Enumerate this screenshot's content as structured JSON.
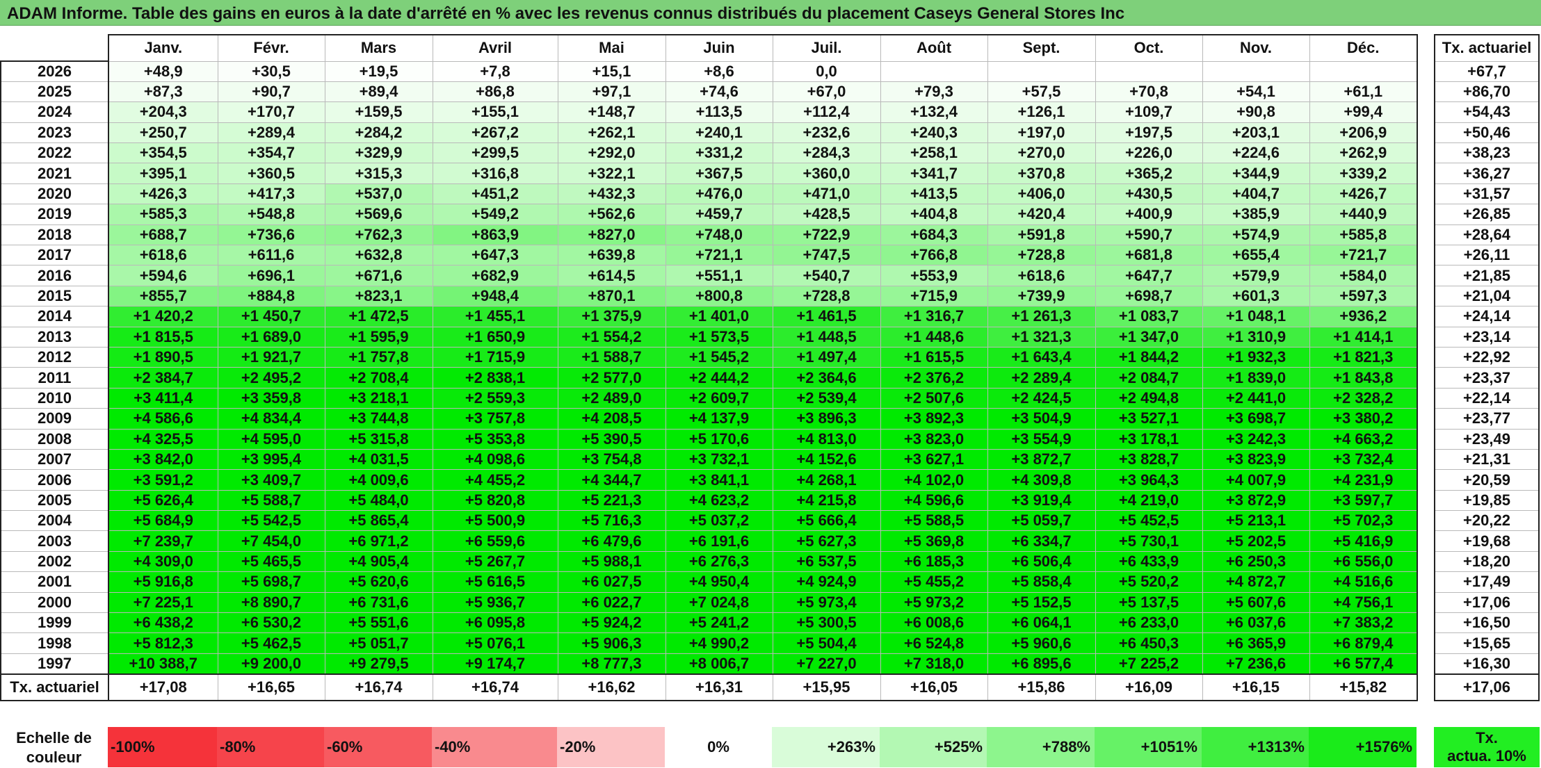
{
  "title": "ADAM Informe. Table des gains en euros à la date d'arrêté en % avec les revenus connus distribués du placement Caseys General Stores Inc",
  "months": [
    "Janv.",
    "Févr.",
    "Mars",
    "Avril",
    "Mai",
    "Juin",
    "Juil.",
    "Août",
    "Sept.",
    "Oct.",
    "Nov.",
    "Déc."
  ],
  "act_header": "Tx. actuariel",
  "rows": [
    {
      "year": "2026",
      "values": [
        "+48,9",
        "+30,5",
        "+19,5",
        "+7,8",
        "+15,1",
        "+8,6",
        "0,0",
        "",
        "",
        "",
        "",
        ""
      ],
      "act": "+67,7"
    },
    {
      "year": "2025",
      "values": [
        "+87,3",
        "+90,7",
        "+89,4",
        "+86,8",
        "+97,1",
        "+74,6",
        "+67,0",
        "+79,3",
        "+57,5",
        "+70,8",
        "+54,1",
        "+61,1"
      ],
      "act": "+86,70"
    },
    {
      "year": "2024",
      "values": [
        "+204,3",
        "+170,7",
        "+159,5",
        "+155,1",
        "+148,7",
        "+113,5",
        "+112,4",
        "+132,4",
        "+126,1",
        "+109,7",
        "+90,8",
        "+99,4"
      ],
      "act": "+54,43"
    },
    {
      "year": "2023",
      "values": [
        "+250,7",
        "+289,4",
        "+284,2",
        "+267,2",
        "+262,1",
        "+240,1",
        "+232,6",
        "+240,3",
        "+197,0",
        "+197,5",
        "+203,1",
        "+206,9"
      ],
      "act": "+50,46"
    },
    {
      "year": "2022",
      "values": [
        "+354,5",
        "+354,7",
        "+329,9",
        "+299,5",
        "+292,0",
        "+331,2",
        "+284,3",
        "+258,1",
        "+270,0",
        "+226,0",
        "+224,6",
        "+262,9"
      ],
      "act": "+38,23"
    },
    {
      "year": "2021",
      "values": [
        "+395,1",
        "+360,5",
        "+315,3",
        "+316,8",
        "+322,1",
        "+367,5",
        "+360,0",
        "+341,7",
        "+370,8",
        "+365,2",
        "+344,9",
        "+339,2"
      ],
      "act": "+36,27"
    },
    {
      "year": "2020",
      "values": [
        "+426,3",
        "+417,3",
        "+537,0",
        "+451,2",
        "+432,3",
        "+476,0",
        "+471,0",
        "+413,5",
        "+406,0",
        "+430,5",
        "+404,7",
        "+426,7"
      ],
      "act": "+31,57"
    },
    {
      "year": "2019",
      "values": [
        "+585,3",
        "+548,8",
        "+569,6",
        "+549,2",
        "+562,6",
        "+459,7",
        "+428,5",
        "+404,8",
        "+420,4",
        "+400,9",
        "+385,9",
        "+440,9"
      ],
      "act": "+26,85"
    },
    {
      "year": "2018",
      "values": [
        "+688,7",
        "+736,6",
        "+762,3",
        "+863,9",
        "+827,0",
        "+748,0",
        "+722,9",
        "+684,3",
        "+591,8",
        "+590,7",
        "+574,9",
        "+585,8"
      ],
      "act": "+28,64"
    },
    {
      "year": "2017",
      "values": [
        "+618,6",
        "+611,6",
        "+632,8",
        "+647,3",
        "+639,8",
        "+721,1",
        "+747,5",
        "+766,8",
        "+728,8",
        "+681,8",
        "+655,4",
        "+721,7"
      ],
      "act": "+26,11"
    },
    {
      "year": "2016",
      "values": [
        "+594,6",
        "+696,1",
        "+671,6",
        "+682,9",
        "+614,5",
        "+551,1",
        "+540,7",
        "+553,9",
        "+618,6",
        "+647,7",
        "+579,9",
        "+584,0"
      ],
      "act": "+21,85"
    },
    {
      "year": "2015",
      "values": [
        "+855,7",
        "+884,8",
        "+823,1",
        "+948,4",
        "+870,1",
        "+800,8",
        "+728,8",
        "+715,9",
        "+739,9",
        "+698,7",
        "+601,3",
        "+597,3"
      ],
      "act": "+21,04"
    },
    {
      "year": "2014",
      "values": [
        "+1 420,2",
        "+1 450,7",
        "+1 472,5",
        "+1 455,1",
        "+1 375,9",
        "+1 401,0",
        "+1 461,5",
        "+1 316,7",
        "+1 261,3",
        "+1 083,7",
        "+1 048,1",
        "+936,2"
      ],
      "act": "+24,14"
    },
    {
      "year": "2013",
      "values": [
        "+1 815,5",
        "+1 689,0",
        "+1 595,9",
        "+1 650,9",
        "+1 554,2",
        "+1 573,5",
        "+1 448,5",
        "+1 448,6",
        "+1 321,3",
        "+1 347,0",
        "+1 310,9",
        "+1 414,1"
      ],
      "act": "+23,14"
    },
    {
      "year": "2012",
      "values": [
        "+1 890,5",
        "+1 921,7",
        "+1 757,8",
        "+1 715,9",
        "+1 588,7",
        "+1 545,2",
        "+1 497,4",
        "+1 615,5",
        "+1 643,4",
        "+1 844,2",
        "+1 932,3",
        "+1 821,3"
      ],
      "act": "+22,92"
    },
    {
      "year": "2011",
      "values": [
        "+2 384,7",
        "+2 495,2",
        "+2 708,4",
        "+2 838,1",
        "+2 577,0",
        "+2 444,2",
        "+2 364,6",
        "+2 376,2",
        "+2 289,4",
        "+2 084,7",
        "+1 839,0",
        "+1 843,8"
      ],
      "act": "+23,37"
    },
    {
      "year": "2010",
      "values": [
        "+3 411,4",
        "+3 359,8",
        "+3 218,1",
        "+2 559,3",
        "+2 489,0",
        "+2 609,7",
        "+2 539,4",
        "+2 507,6",
        "+2 424,5",
        "+2 494,8",
        "+2 441,0",
        "+2 328,2"
      ],
      "act": "+22,14"
    },
    {
      "year": "2009",
      "values": [
        "+4 586,6",
        "+4 834,4",
        "+3 744,8",
        "+3 757,8",
        "+4 208,5",
        "+4 137,9",
        "+3 896,3",
        "+3 892,3",
        "+3 504,9",
        "+3 527,1",
        "+3 698,7",
        "+3 380,2"
      ],
      "act": "+23,77"
    },
    {
      "year": "2008",
      "values": [
        "+4 325,5",
        "+4 595,0",
        "+5 315,8",
        "+5 353,8",
        "+5 390,5",
        "+5 170,6",
        "+4 813,0",
        "+3 823,0",
        "+3 554,9",
        "+3 178,1",
        "+3 242,3",
        "+4 663,2"
      ],
      "act": "+23,49"
    },
    {
      "year": "2007",
      "values": [
        "+3 842,0",
        "+3 995,4",
        "+4 031,5",
        "+4 098,6",
        "+3 754,8",
        "+3 732,1",
        "+4 152,6",
        "+3 627,1",
        "+3 872,7",
        "+3 828,7",
        "+3 823,9",
        "+3 732,4"
      ],
      "act": "+21,31"
    },
    {
      "year": "2006",
      "values": [
        "+3 591,2",
        "+3 409,7",
        "+4 009,6",
        "+4 455,2",
        "+4 344,7",
        "+3 841,1",
        "+4 268,1",
        "+4 102,0",
        "+4 309,8",
        "+3 964,3",
        "+4 007,9",
        "+4 231,9"
      ],
      "act": "+20,59"
    },
    {
      "year": "2005",
      "values": [
        "+5 626,4",
        "+5 588,7",
        "+5 484,0",
        "+5 820,8",
        "+5 221,3",
        "+4 623,2",
        "+4 215,8",
        "+4 596,6",
        "+3 919,4",
        "+4 219,0",
        "+3 872,9",
        "+3 597,7"
      ],
      "act": "+19,85"
    },
    {
      "year": "2004",
      "values": [
        "+5 684,9",
        "+5 542,5",
        "+5 865,4",
        "+5 500,9",
        "+5 716,3",
        "+5 037,2",
        "+5 666,4",
        "+5 588,5",
        "+5 059,7",
        "+5 452,5",
        "+5 213,1",
        "+5 702,3"
      ],
      "act": "+20,22"
    },
    {
      "year": "2003",
      "values": [
        "+7 239,7",
        "+7 454,0",
        "+6 971,2",
        "+6 559,6",
        "+6 479,6",
        "+6 191,6",
        "+5 627,3",
        "+5 369,8",
        "+6 334,7",
        "+5 730,1",
        "+5 202,5",
        "+5 416,9"
      ],
      "act": "+19,68"
    },
    {
      "year": "2002",
      "values": [
        "+4 309,0",
        "+5 465,5",
        "+4 905,4",
        "+5 267,7",
        "+5 988,1",
        "+6 276,3",
        "+6 537,5",
        "+6 185,3",
        "+6 506,4",
        "+6 433,9",
        "+6 250,3",
        "+6 556,0"
      ],
      "act": "+18,20"
    },
    {
      "year": "2001",
      "values": [
        "+5 916,8",
        "+5 698,7",
        "+5 620,6",
        "+5 616,5",
        "+6 027,5",
        "+4 950,4",
        "+4 924,9",
        "+5 455,2",
        "+5 858,4",
        "+5 520,2",
        "+4 872,7",
        "+4 516,6"
      ],
      "act": "+17,49"
    },
    {
      "year": "2000",
      "values": [
        "+7 225,1",
        "+8 890,7",
        "+6 731,6",
        "+5 936,7",
        "+6 022,7",
        "+7 024,8",
        "+5 973,4",
        "+5 973,2",
        "+5 152,5",
        "+5 137,5",
        "+5 607,6",
        "+4 756,1"
      ],
      "act": "+17,06"
    },
    {
      "year": "1999",
      "values": [
        "+6 438,2",
        "+6 530,2",
        "+5 551,6",
        "+6 095,8",
        "+5 924,2",
        "+5 241,2",
        "+5 300,5",
        "+6 008,6",
        "+6 064,1",
        "+6 233,0",
        "+6 037,6",
        "+7 383,2"
      ],
      "act": "+16,50"
    },
    {
      "year": "1998",
      "values": [
        "+5 812,3",
        "+5 462,5",
        "+5 051,7",
        "+5 076,1",
        "+5 906,3",
        "+4 990,2",
        "+5 504,4",
        "+6 524,8",
        "+5 960,6",
        "+6 450,3",
        "+6 365,9",
        "+6 879,4"
      ],
      "act": "+15,65"
    },
    {
      "year": "1997",
      "values": [
        "+10 388,7",
        "+9 200,0",
        "+9 279,5",
        "+9 174,7",
        "+8 777,3",
        "+8 006,7",
        "+7 227,0",
        "+7 318,0",
        "+6 895,6",
        "+7 225,2",
        "+7 236,6",
        "+6 577,4"
      ],
      "act": "+16,30"
    }
  ],
  "total_row": {
    "label": "Tx. actuariel",
    "values": [
      "+17,08",
      "+16,65",
      "+16,74",
      "+16,74",
      "+16,62",
      "+16,31",
      "+15,95",
      "+16,05",
      "+15,86",
      "+16,09",
      "+16,15",
      "+15,82"
    ],
    "act": "+17,06"
  },
  "legend": {
    "label_line1": "Echelle de",
    "label_line2": "couleur",
    "items": [
      {
        "label": "-100%",
        "color": "#f5333a",
        "kind": "neg"
      },
      {
        "label": "-80%",
        "color": "#f6444b",
        "kind": "neg"
      },
      {
        "label": "-60%",
        "color": "#f75a60",
        "kind": "neg"
      },
      {
        "label": "-40%",
        "color": "#f98a8e",
        "kind": "neg"
      },
      {
        "label": "-20%",
        "color": "#fcc3c5",
        "kind": "neg"
      },
      {
        "label": "0%",
        "color": "#ffffff",
        "kind": "zero"
      },
      {
        "label": "+263%",
        "color": "#d9fcd9",
        "kind": "pos"
      },
      {
        "label": "+525%",
        "color": "#b3f8b3",
        "kind": "pos"
      },
      {
        "label": "+788%",
        "color": "#8df58d",
        "kind": "pos"
      },
      {
        "label": "+1051%",
        "color": "#66f266",
        "kind": "pos"
      },
      {
        "label": "+1313%",
        "color": "#40ee40",
        "kind": "pos"
      },
      {
        "label": "+1576%",
        "color": "#1aeb1a",
        "kind": "pos"
      }
    ],
    "act_line1": "Tx.",
    "act_line2": "actua. 10%",
    "act_color": "#22ee22"
  }
}
